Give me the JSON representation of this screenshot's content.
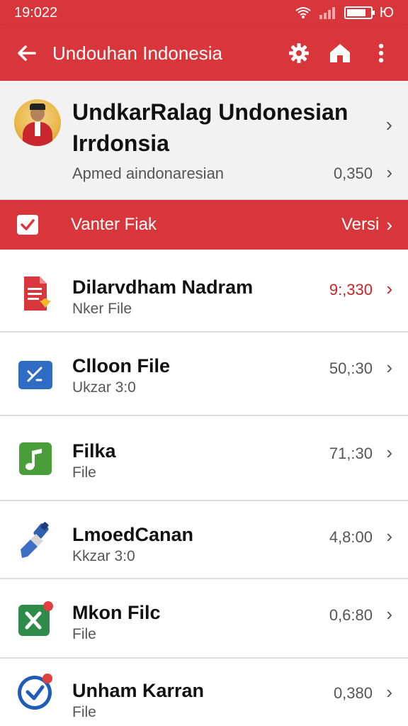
{
  "status": {
    "time": "19:022",
    "right_text": "Ю"
  },
  "app_bar": {
    "title": "Undouhan Indonesia",
    "back_icon": "arrow-left-icon",
    "actions": [
      "gear-icon",
      "home-icon",
      "more-vert-icon"
    ]
  },
  "profile": {
    "name_line1": "UndkarRalag Undonesian",
    "name_line2": "Irrdonsia",
    "subtitle": "Apmed aindonaresian",
    "value": "0,350"
  },
  "section": {
    "label": "Vanter Fiak",
    "right_label": "Versi"
  },
  "files": [
    {
      "name": "Dilarvdham Nadram",
      "sub": "Nker File",
      "value": "9:,330",
      "icon": "document-icon",
      "accent": "#cc2229"
    },
    {
      "name": "Clloon File",
      "sub": "Ukzar 3:0",
      "value": "50,:30",
      "icon": "blue-file-icon",
      "accent": "#555555"
    },
    {
      "name": "Filka",
      "sub": "File",
      "value": "71,:30",
      "icon": "music-icon",
      "accent": "#555555"
    },
    {
      "name": "LmoedCanan",
      "sub": "Kkzar 3:0",
      "value": "4,8:00",
      "icon": "brush-icon",
      "accent": "#555555"
    },
    {
      "name": "Mkon Filc",
      "sub": "File",
      "value": "0,6:80",
      "icon": "excel-icon",
      "accent": "#555555"
    },
    {
      "name": "Unham Karran",
      "sub": "File",
      "value": "0,380",
      "icon": "check-circle-icon",
      "accent": "#555555"
    }
  ],
  "colors": {
    "primary": "#d9363b",
    "highlight": "#cc2229"
  }
}
